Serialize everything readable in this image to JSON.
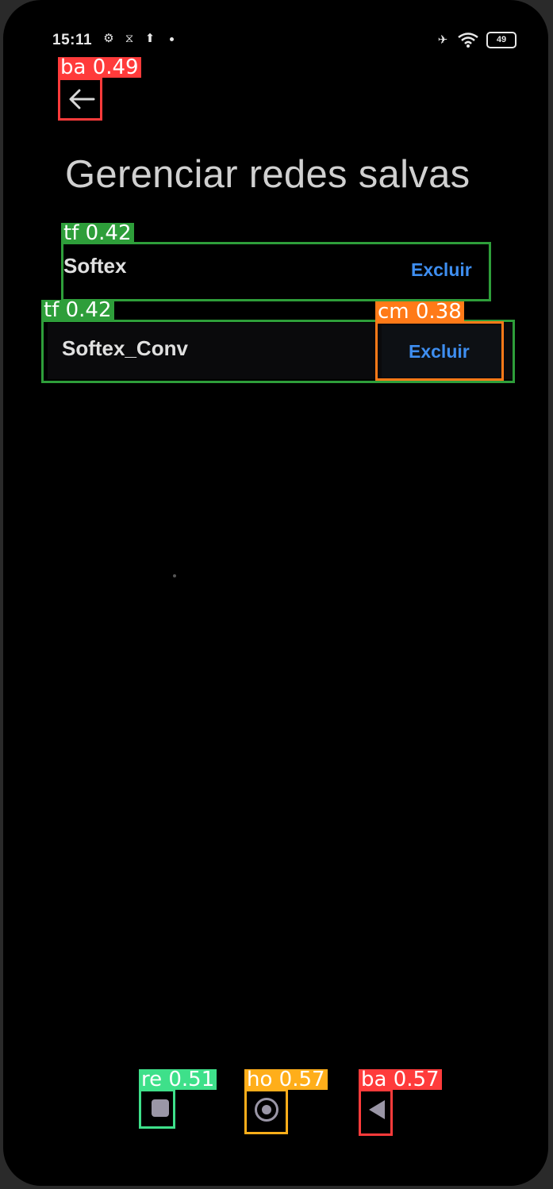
{
  "status_bar": {
    "time": "15:11",
    "battery": "49",
    "icons": [
      "gear-icon",
      "sync-icon",
      "upload-icon",
      "dot-icon",
      "airplane-icon",
      "wifi-icon",
      "battery-icon"
    ]
  },
  "header": {
    "back_icon": "back-arrow-icon",
    "title": "Gerenciar redes salvas"
  },
  "networks": [
    {
      "name": "Softex",
      "action": "Excluir"
    },
    {
      "name": "Softex_Conv",
      "action": "Excluir"
    }
  ],
  "nav_bar": {
    "recent_icon": "recent-apps-icon",
    "home_icon": "home-icon",
    "back_icon": "back-triangle-icon"
  },
  "annotations": [
    {
      "label": "ba 0.49",
      "color": "#ff3b3b"
    },
    {
      "label": "tf 0.42",
      "color": "#2e9e3a"
    },
    {
      "label": "tf 0.42",
      "color": "#2e9e3a"
    },
    {
      "label": "cm 0.38",
      "color": "#ff7a18"
    },
    {
      "label": "re 0.51",
      "color": "#3ee08a"
    },
    {
      "label": "ho 0.57",
      "color": "#ffae1a"
    },
    {
      "label": "ba 0.57",
      "color": "#ff3b3b"
    }
  ]
}
